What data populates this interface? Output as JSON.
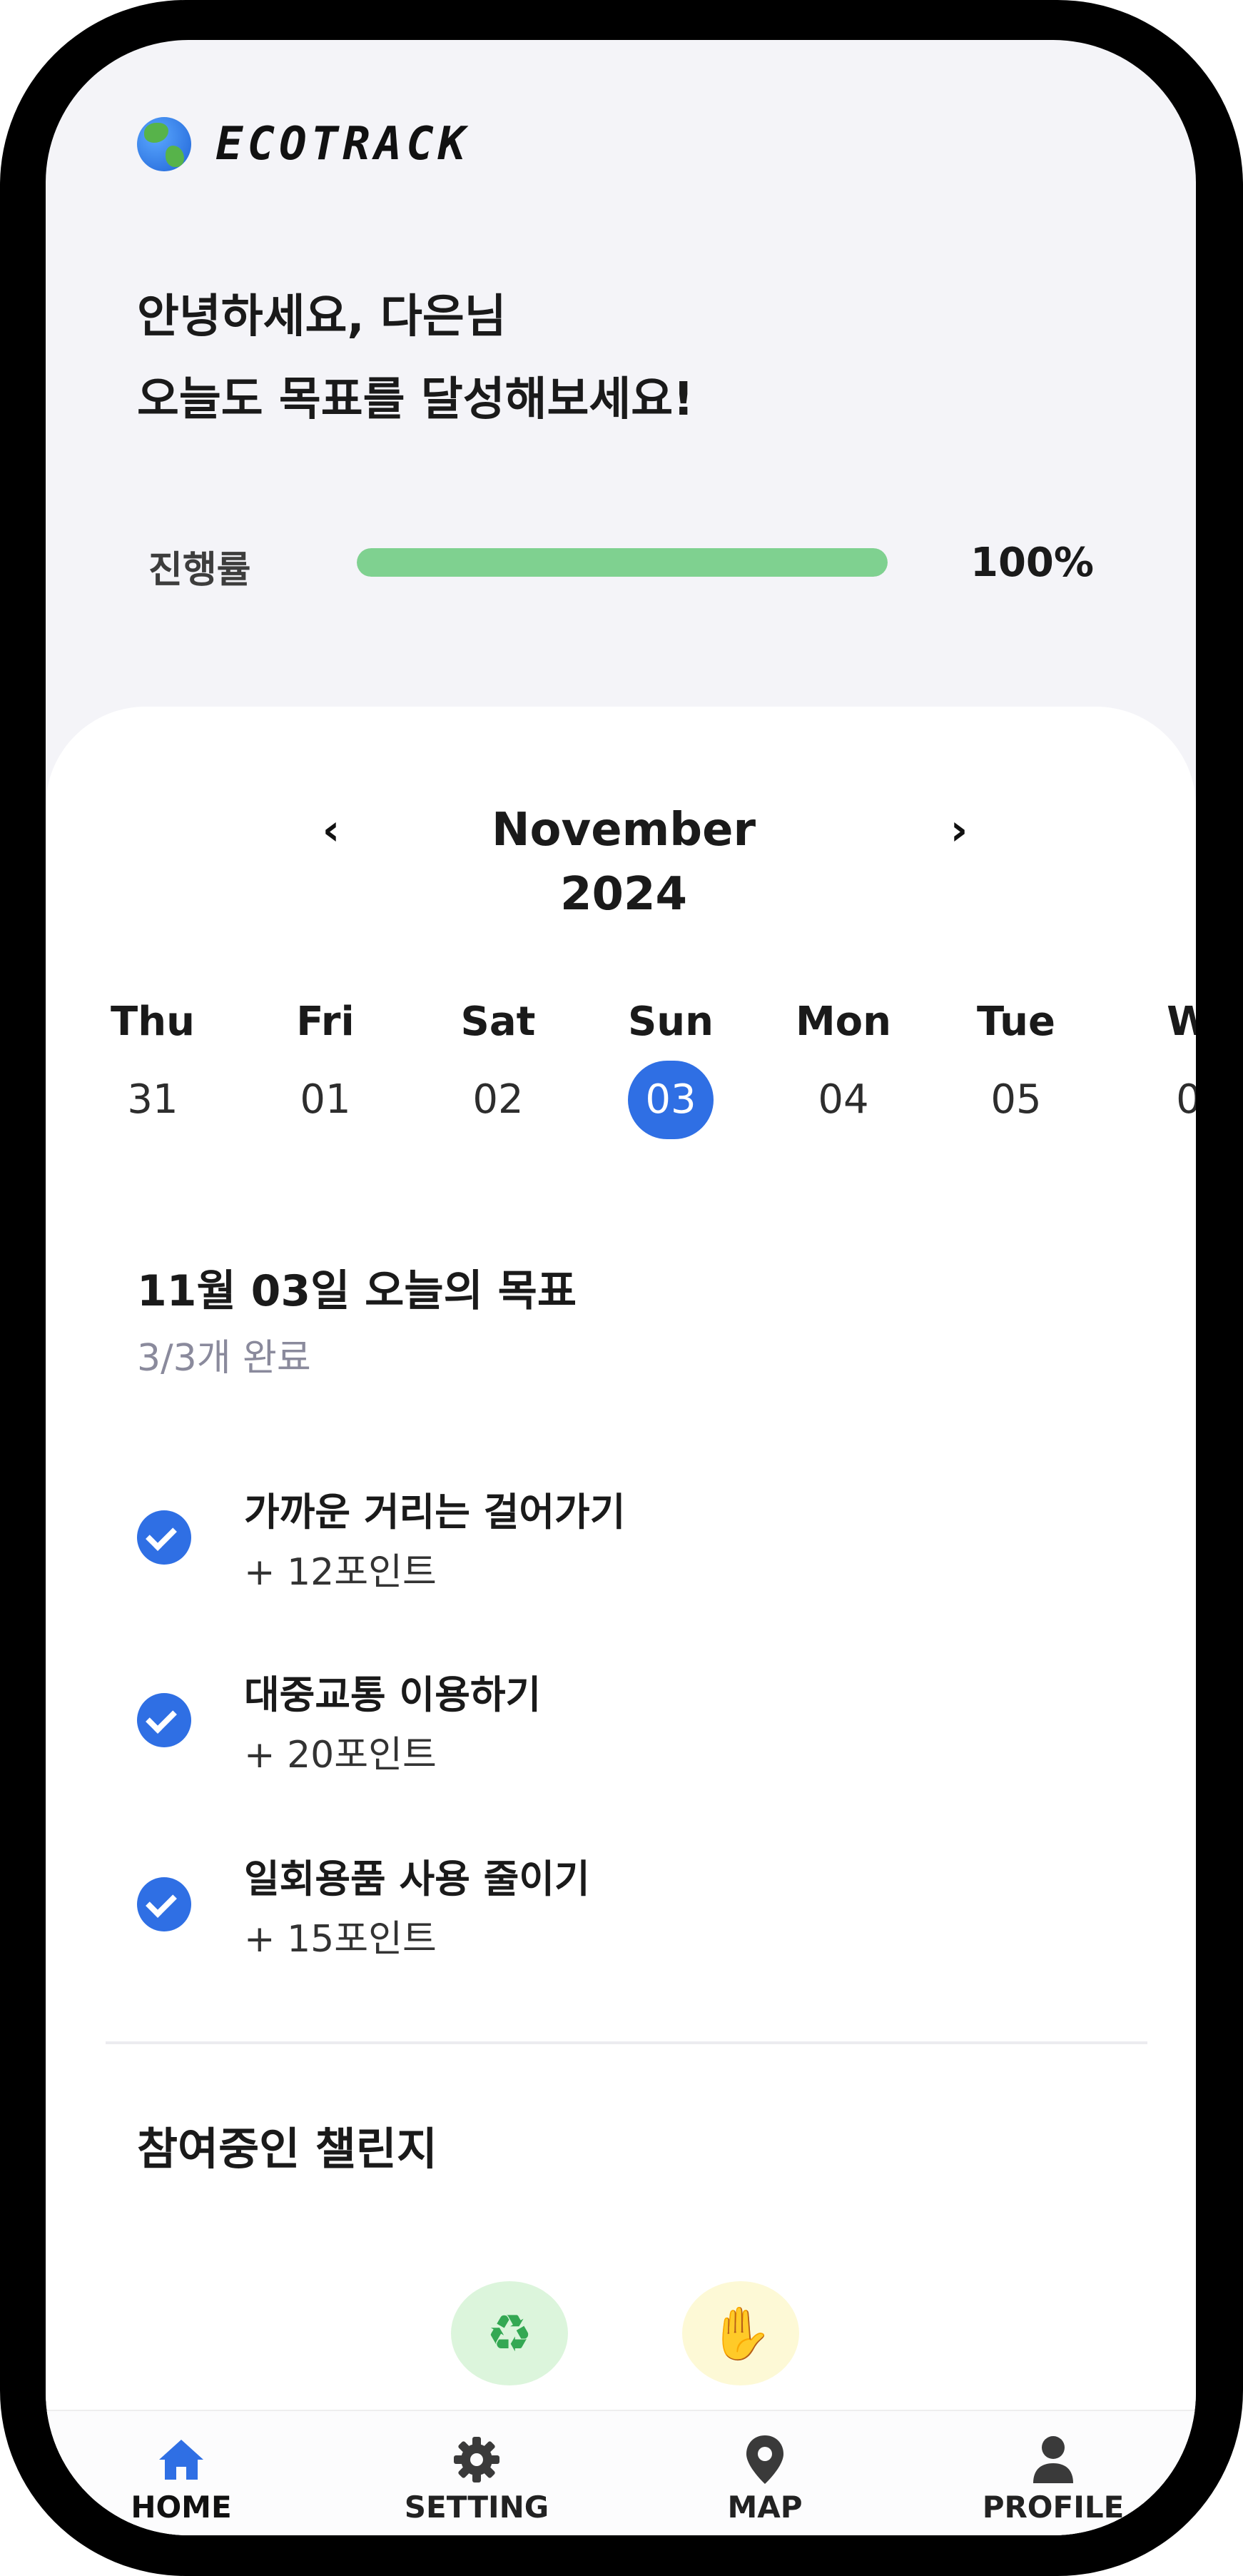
{
  "app": {
    "name": "ECOTRACK"
  },
  "greeting": {
    "line1": "안녕하세요, 다은님",
    "line2": "오늘도 목표를 달성해보세요!"
  },
  "progress": {
    "label": "진행률",
    "value_text": "100%",
    "fraction": 1.0,
    "color": "#7fd190"
  },
  "calendar": {
    "month_label": "November 2024",
    "prev": "‹",
    "next": "›",
    "days": [
      {
        "name": "Thu",
        "num": "31"
      },
      {
        "name": "Fri",
        "num": "01"
      },
      {
        "name": "Sat",
        "num": "02"
      },
      {
        "name": "Sun",
        "num": "03",
        "selected": true
      },
      {
        "name": "Mon",
        "num": "04"
      },
      {
        "name": "Tue",
        "num": "05"
      },
      {
        "name": "W",
        "num": "0"
      }
    ]
  },
  "goals": {
    "title": "11월 03일 오늘의 목표",
    "count": "3/3개 완료",
    "items": [
      {
        "title": "가까운 거리는 걸어가기",
        "points": "+ 12포인트",
        "done": true
      },
      {
        "title": "대중교통 이용하기",
        "points": "+ 20포인트",
        "done": true
      },
      {
        "title": "일회용품 사용 줄이기",
        "points": "+ 15포인트",
        "done": true
      }
    ]
  },
  "challenges": {
    "title": "참여중인 챌린지",
    "badges": [
      {
        "icon": "recycle-icon",
        "glyph": "♻"
      },
      {
        "icon": "waving-hand-icon",
        "glyph": "✋"
      }
    ]
  },
  "tabbar": {
    "items": [
      {
        "label": "HOME",
        "icon": "home-icon",
        "active": true
      },
      {
        "label": "SETTING",
        "icon": "gear-icon"
      },
      {
        "label": "MAP",
        "icon": "map-pin-icon"
      },
      {
        "label": "PROFILE",
        "icon": "user-icon"
      }
    ]
  },
  "colors": {
    "accent": "#2f6fe4",
    "background": "#f4f4f8",
    "progress": "#7fd190"
  }
}
